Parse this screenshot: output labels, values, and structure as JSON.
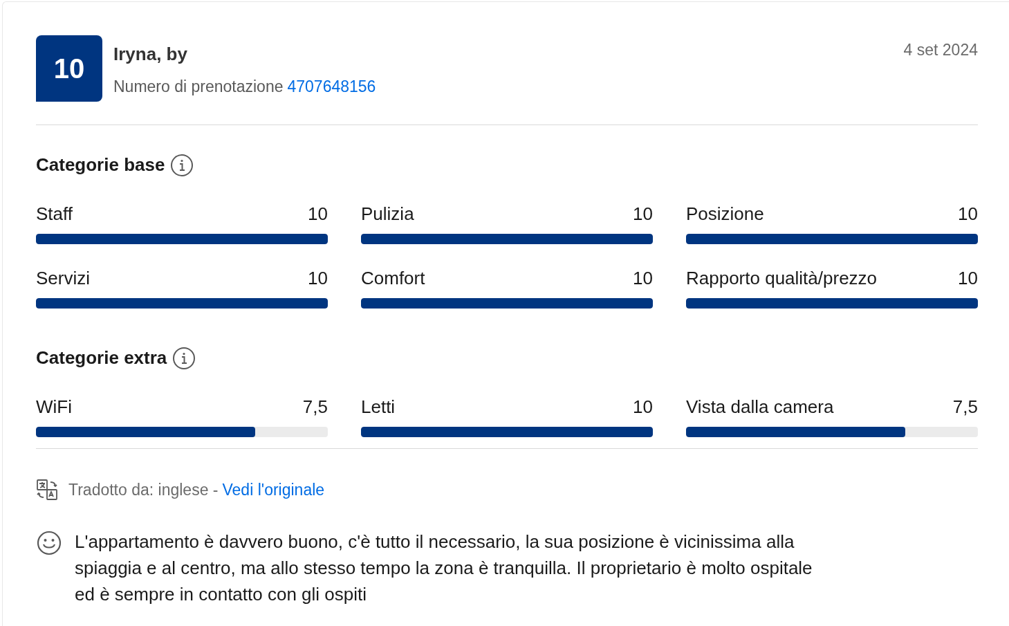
{
  "review": {
    "score": "10",
    "author": "Iryna, by",
    "booking_label": "Numero di prenotazione",
    "booking_number": "4707648156",
    "date": "4 set 2024"
  },
  "sections": [
    {
      "title": "Categorie base",
      "categories": [
        {
          "name": "Staff",
          "score": "10",
          "level": 1
        },
        {
          "name": "Pulizia",
          "score": "10",
          "level": 1
        },
        {
          "name": "Posizione",
          "score": "10",
          "level": 1
        },
        {
          "name": "Servizi",
          "score": "10",
          "level": 1
        },
        {
          "name": "Comfort",
          "score": "10",
          "level": 1
        },
        {
          "name": "Rapporto qualità/prezzo",
          "score": "10",
          "level": 1
        }
      ]
    },
    {
      "title": "Categorie extra",
      "categories": [
        {
          "name": "WiFi",
          "score": "7,5",
          "level": 0.75
        },
        {
          "name": "Letti",
          "score": "10",
          "level": 1
        },
        {
          "name": "Vista dalla camera",
          "score": "7,5",
          "level": 0.75
        }
      ]
    }
  ],
  "translation": {
    "label": "Tradotto da: inglese -",
    "link": "Vedi l'originale"
  },
  "comment": "L'appartamento è davvero buono, c'è tutto il necessario, la sua posizione è vicinissima alla spiaggia e al centro, ma allo stesso tempo la zona è tranquilla. Il proprietario è molto ospitale ed è sempre in contatto con gli ospiti"
}
